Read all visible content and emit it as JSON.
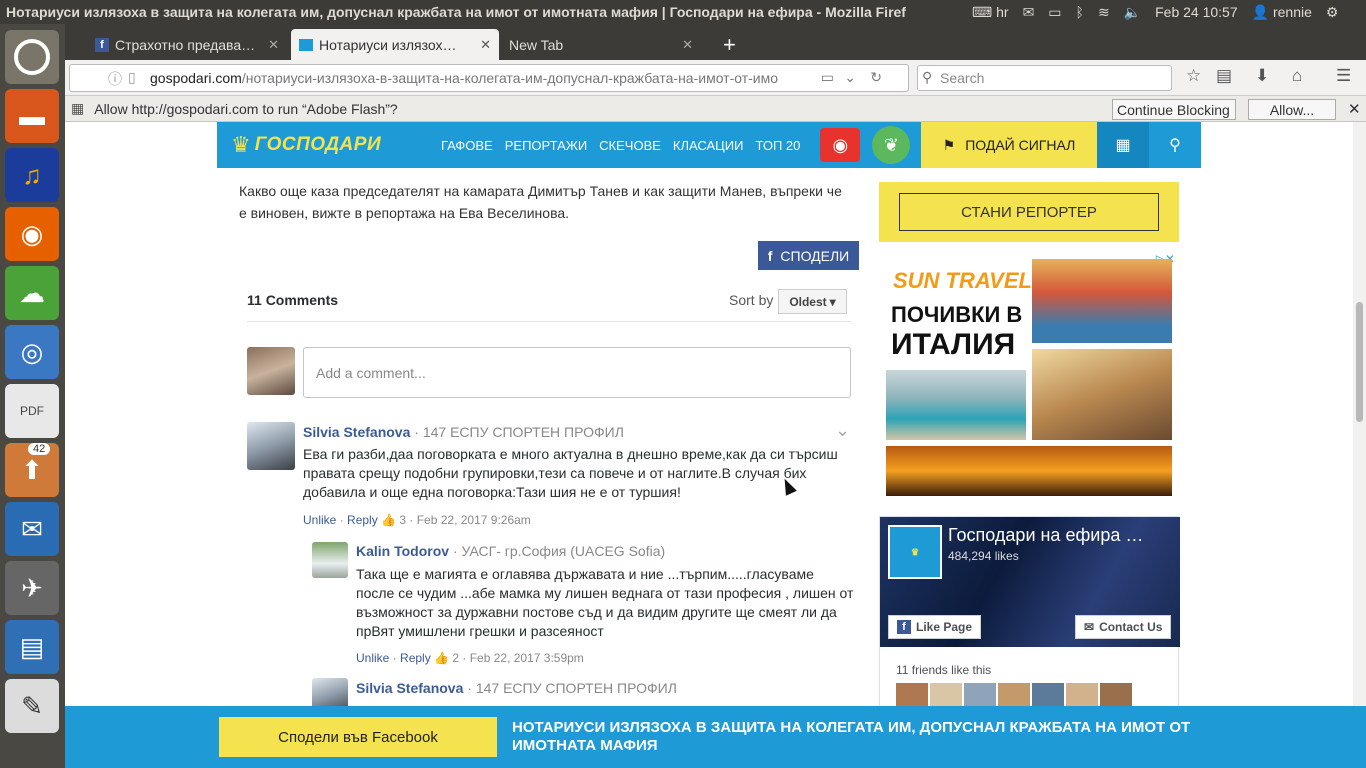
{
  "os": {
    "window_title": "Нотариуси излязоха в защита на колегата им, допуснал кражбата на имот от имотната мафия | Господари на ефира - Mozilla Firef",
    "keyboard_layout": "hr",
    "datetime": "Feb 24 10:57",
    "user": "rennie",
    "launcher_badge": "42"
  },
  "browser": {
    "tabs": [
      {
        "label": "Страхотно предава…",
        "active": false
      },
      {
        "label": "Нотариуси излязох…",
        "active": true
      },
      {
        "label": "New Tab",
        "active": false
      }
    ],
    "url_domain": "gospodari.com",
    "url_path": "/нотариуси-излязоха-в-защита-на-колегата-им-допуснал-кражбата-на-имот-от-имо",
    "search_placeholder": "Search",
    "flash_prompt": "Allow http://gospodari.com to run “Adobe Flash”?",
    "continue_blocking": "Continue Blocking",
    "allow": "Allow..."
  },
  "site": {
    "logo": "ГОСПОДАРИ",
    "nav": [
      "ГАФОВЕ",
      "РЕПОРТАЖИ",
      "СКЕЧОВЕ",
      "КЛАСАЦИИ",
      "ТОП 20"
    ],
    "signal_label": "ПОДАЙ СИГНАЛ"
  },
  "article": {
    "text": "Какво още каза председателят на камарата Димитър Танев и как защити Манев, въпреки че е виновен, вижте в репортажа на Ева Веселинова.",
    "share_label": "СПОДЕЛИ"
  },
  "comments": {
    "count_label": "11 Comments",
    "sort_label": "Sort by",
    "sort_value": "Oldest",
    "placeholder": "Add a comment...",
    "items": [
      {
        "author": "Silvia Stefanova",
        "badge": "· 147 ЕСПУ СПОРТЕН ПРОФИЛ",
        "text": "Ева ги разби,даа поговорката е много актуална в днешно време,как да си търсиш правата срещу подобни групировки,тези са повече и от наглите.В случая бих добавила и още една поговорка:Тази шия не е от туршия!",
        "like": "Unlike",
        "reply": "Reply",
        "likes": "3",
        "date": "Feb 22, 2017 9:26am"
      },
      {
        "author": "Kalin Todorov",
        "badge": "· УАСГ- гр.София (UACEG Sofia)",
        "text": "Така ще е магията е оглавява държавата и ние ...търпим.....гласуваме после се чудим ...абе мамка му лишен веднага от тази професия , лишен от възможност за дуржавни постове съд и да видим другите ще смеят ли да прВят умишлени грешки и разсеяност",
        "like": "Unlike",
        "reply": "Reply",
        "likes": "2",
        "date": "Feb 22, 2017 3:59pm"
      },
      {
        "author": "Silvia Stefanova",
        "badge": "· 147 ЕСПУ СПОРТЕН ПРОФИЛ"
      }
    ]
  },
  "sidebar": {
    "reporter_btn": "СТАНИ РЕПОРТЕР",
    "ad_brand": "SUN TRAVEL",
    "ad_line1": "ПОЧИВКИ В",
    "ad_line2": "ИТАЛИЯ",
    "fb_page_name": "Господари на ефира …",
    "fb_likes": "484,294 likes",
    "fb_like_btn": "Like Page",
    "fb_contact_btn": "Contact Us",
    "fb_friends": "11 friends like this"
  },
  "sharebar": {
    "button": "Сподели във Facebook",
    "title": "НОТАРИУСИ ИЗЛЯЗОХА В ЗАЩИТА НА КОЛЕГАТА ИМ, ДОПУСНАЛ КРАЖБАТА НА ИМОТ ОТ ИМОТНАТА МАФИЯ"
  },
  "colors": {
    "site_blue": "#1e9bd6",
    "site_yellow": "#f4e24e",
    "facebook": "#3b5998",
    "comment_author": "#3b5b96"
  }
}
